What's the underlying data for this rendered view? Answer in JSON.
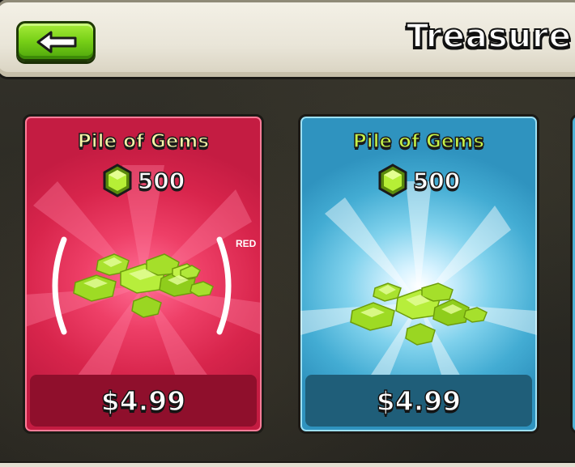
{
  "header": {
    "back_icon": "left-arrow-icon",
    "title": "Treasure"
  },
  "colors": {
    "red_card": "#d8254c",
    "blue_card": "#43acd3",
    "back_button": "#77cf17"
  },
  "cards": [
    {
      "name": "Pile of Gems",
      "gem_icon": "gem-icon",
      "amount": "500",
      "price": "$4.99",
      "label": "RED",
      "theme": "red",
      "selected": true
    },
    {
      "name": "Pile of Gems",
      "gem_icon": "gem-icon",
      "amount": "500",
      "price": "$4.99",
      "theme": "blue",
      "selected": false
    }
  ]
}
